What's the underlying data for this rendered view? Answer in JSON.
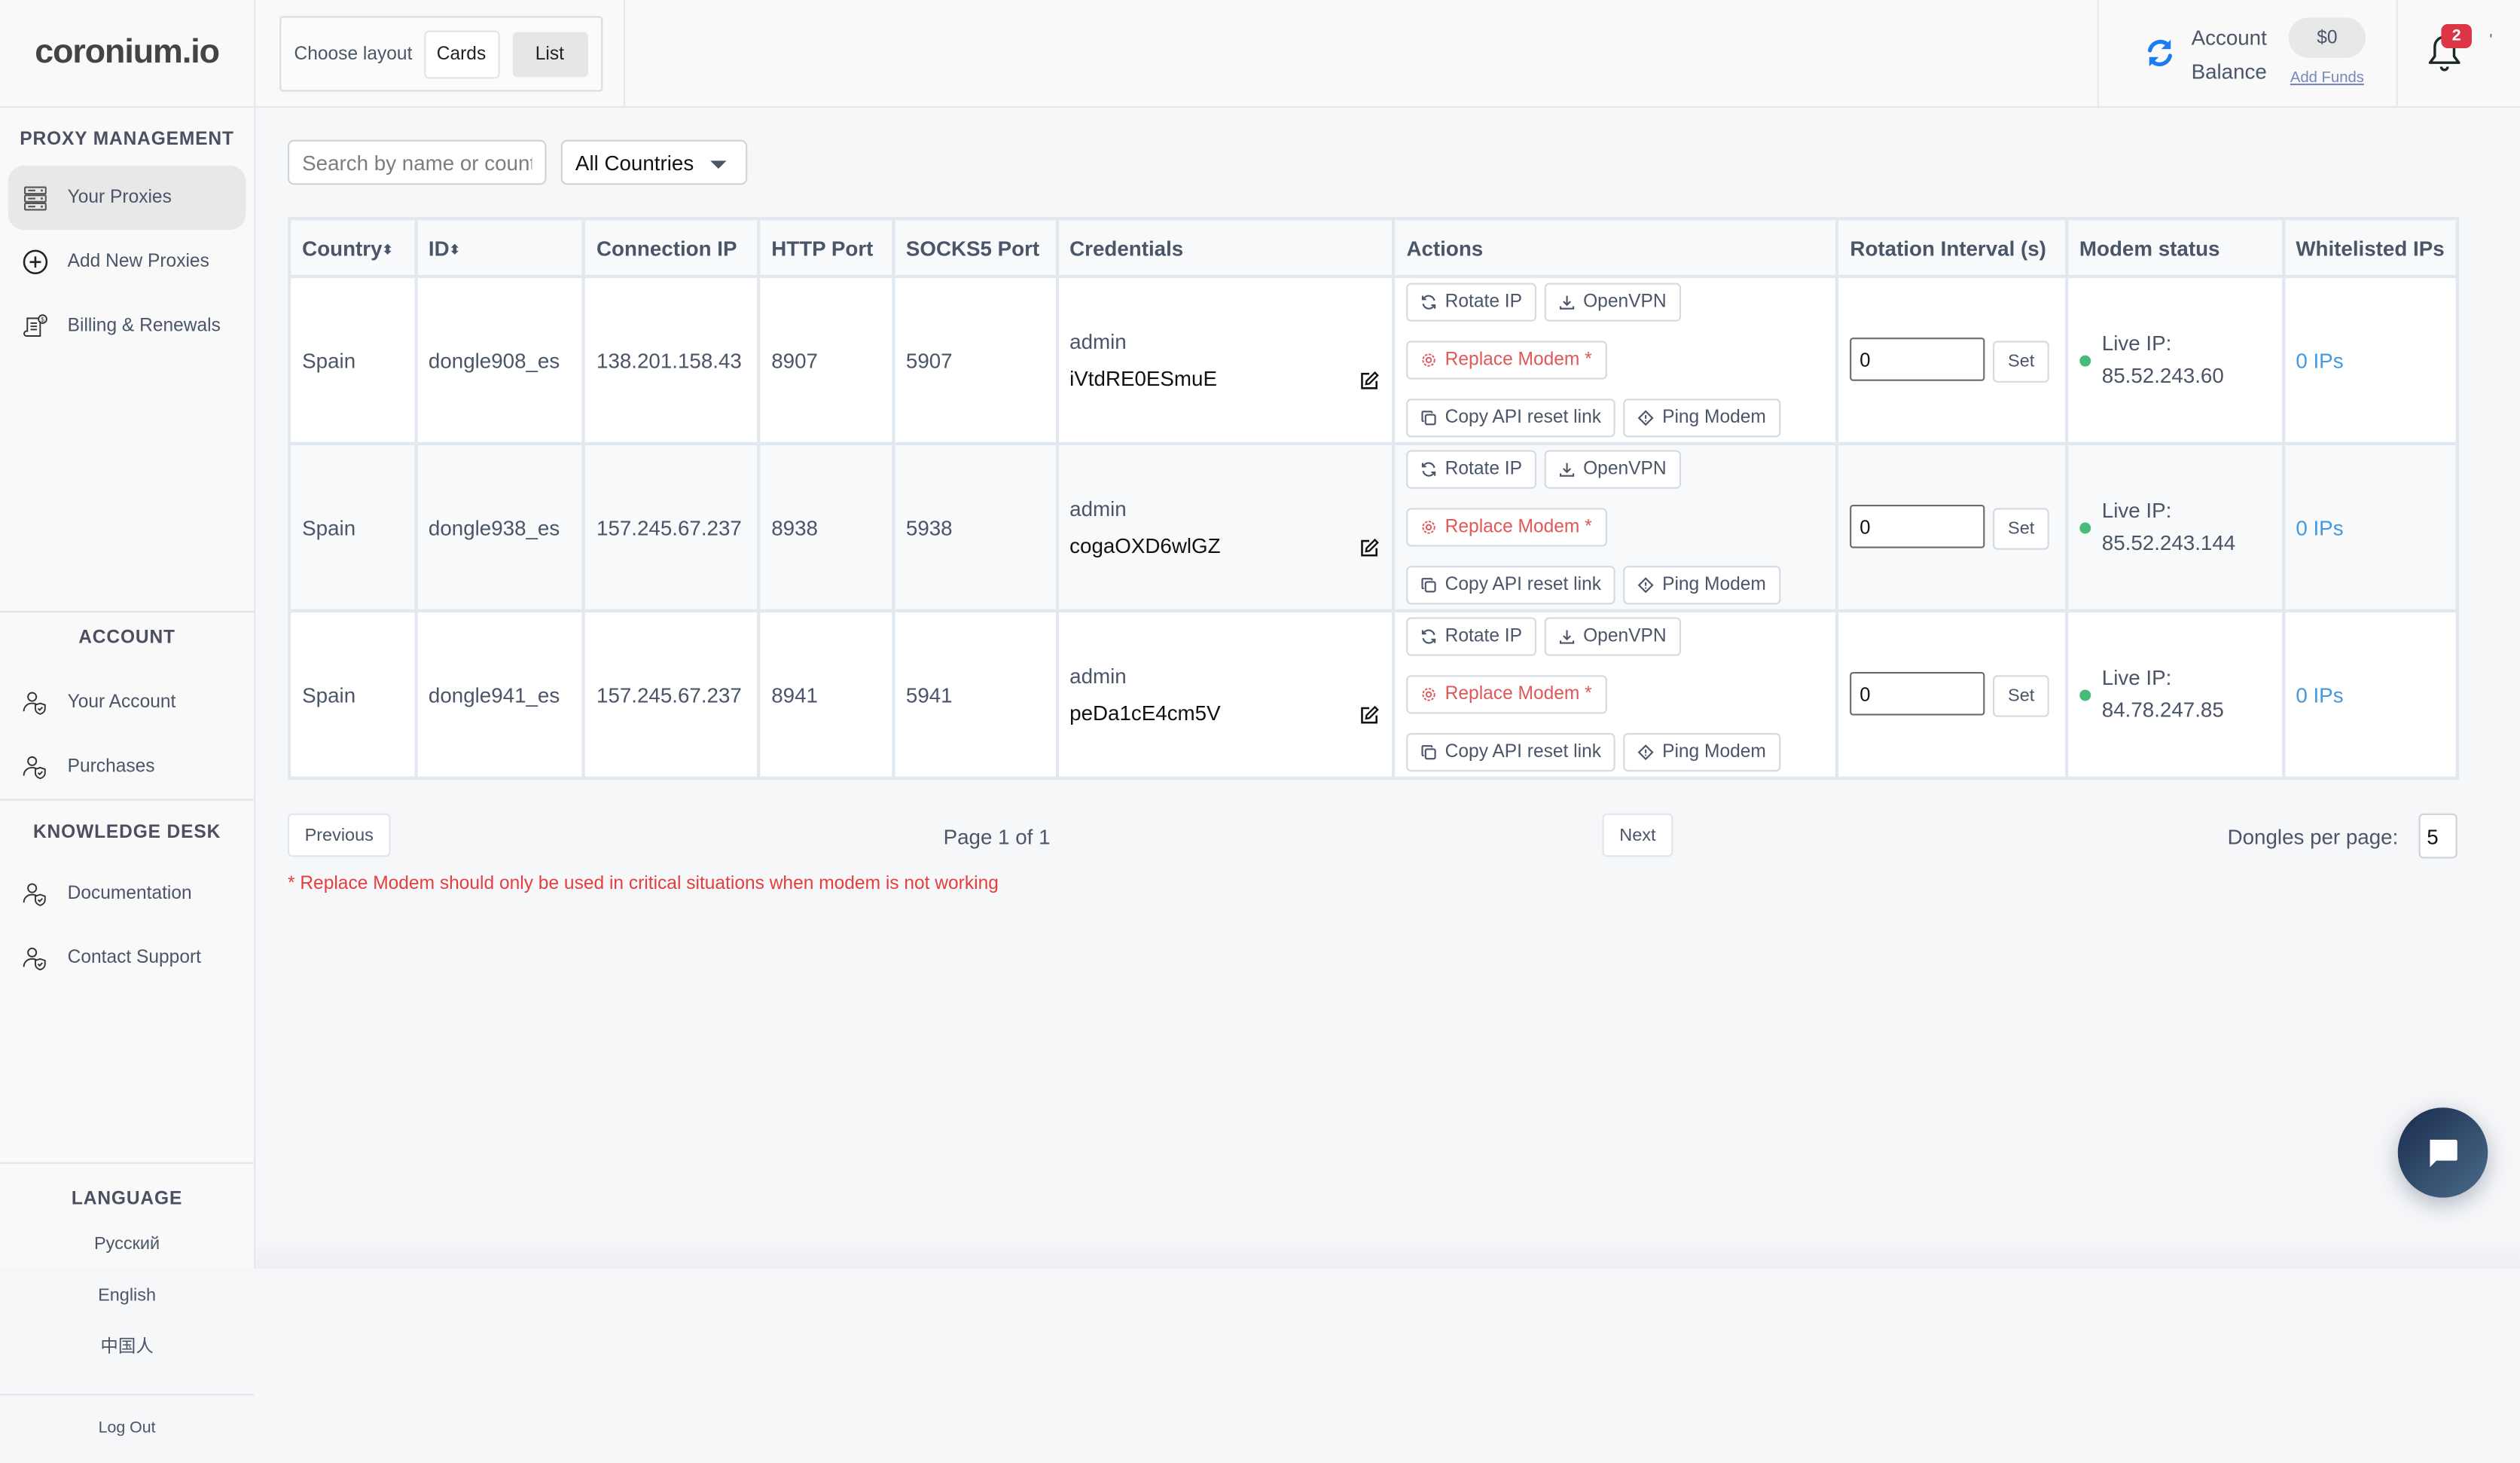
{
  "brand": "coronium.io",
  "header": {
    "layout_label": "Choose layout",
    "layout_options": [
      "Cards",
      "List"
    ],
    "layout_selected": "List",
    "account_label_line1": "Account",
    "account_label_line2": "Balance",
    "balance": "$0",
    "add_funds": "Add Funds",
    "notification_count": "2",
    "trailing_mark": "'"
  },
  "sidebar": {
    "sections": [
      {
        "title": "PROXY MANAGEMENT",
        "items": [
          {
            "label": "Your Proxies",
            "icon": "server-icon",
            "active": true
          },
          {
            "label": "Add New Proxies",
            "icon": "plus-circle-icon"
          },
          {
            "label": "Billing & Renewals",
            "icon": "receipt-dollar-icon"
          }
        ]
      },
      {
        "title": "ACCOUNT",
        "items": [
          {
            "label": "Your Account",
            "icon": "user-shield-icon"
          },
          {
            "label": "Purchases",
            "icon": "user-shield-icon"
          }
        ]
      },
      {
        "title": "KNOWLEDGE DESK",
        "items": [
          {
            "label": "Documentation",
            "icon": "user-shield-icon"
          },
          {
            "label": "Contact Support",
            "icon": "user-shield-icon"
          }
        ]
      }
    ],
    "language": {
      "title": "LANGUAGE",
      "options": [
        "Русский",
        "English",
        "中国人"
      ]
    },
    "logout": "Log Out"
  },
  "filters": {
    "search_placeholder": "Search by name or country",
    "country_selected": "All Countries"
  },
  "table": {
    "columns": [
      "Country",
      "ID",
      "Connection IP",
      "HTTP Port",
      "SOCKS5 Port",
      "Credentials",
      "Actions",
      "Rotation Interval (s)",
      "Modem status",
      "Whitelisted IPs"
    ],
    "sortable": [
      "Country",
      "ID"
    ],
    "action_labels": {
      "rotate": "Rotate IP",
      "openvpn": "OpenVPN",
      "replace": "Replace Modem *",
      "copy_api": "Copy API reset link",
      "ping": "Ping Modem"
    },
    "set_label": "Set",
    "live_ip_label": "Live IP:",
    "rows": [
      {
        "country": "Spain",
        "id": "dongle908_es",
        "connection_ip": "138.201.158.43",
        "http_port": "8907",
        "socks5_port": "5907",
        "username": "admin",
        "password": "iVtdRE0ESmuE",
        "rotation_interval": "0",
        "status": "online",
        "live_ip": "85.52.243.60",
        "whitelisted": "0 IPs"
      },
      {
        "country": "Spain",
        "id": "dongle938_es",
        "connection_ip": "157.245.67.237",
        "http_port": "8938",
        "socks5_port": "5938",
        "username": "admin",
        "password": "cogaOXD6wlGZ",
        "rotation_interval": "0",
        "status": "online",
        "live_ip": "85.52.243.144",
        "whitelisted": "0 IPs"
      },
      {
        "country": "Spain",
        "id": "dongle941_es",
        "connection_ip": "157.245.67.237",
        "http_port": "8941",
        "socks5_port": "5941",
        "username": "admin",
        "password": "peDa1cE4cm5V",
        "rotation_interval": "0",
        "status": "online",
        "live_ip": "84.78.247.85",
        "whitelisted": "0 IPs"
      }
    ]
  },
  "pagination": {
    "previous": "Previous",
    "page_info": "Page 1 of 1",
    "next": "Next",
    "per_page_label": "Dongles per page:",
    "per_page_value": "5"
  },
  "note": "* Replace Modem should only be used in critical situations when modem is not working",
  "colors": {
    "accent": "#4299e1",
    "danger": "#e53e3e",
    "online": "#48bb78",
    "badge": "#dc3545"
  }
}
